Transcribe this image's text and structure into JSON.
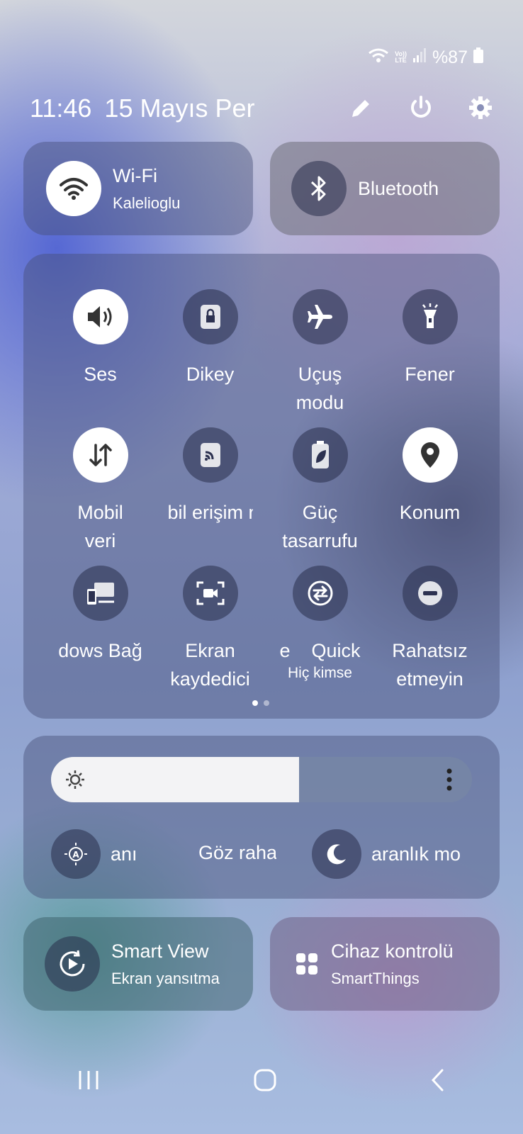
{
  "status_bar": {
    "volte_top": "Vo))",
    "volte_bottom": "LTE",
    "battery_text": "%87"
  },
  "header": {
    "time": "11:46",
    "date": "15 Mayıs Per"
  },
  "wifi": {
    "title": "Wi-Fi",
    "subtitle": "Kalelioglu",
    "state": "on"
  },
  "bluetooth": {
    "title": "Bluetooth",
    "state": "off"
  },
  "quick_settings": [
    {
      "label": "Ses",
      "icon": "speaker-icon",
      "state": "on"
    },
    {
      "label": "Dikey",
      "icon": "lock-rotation-icon",
      "state": "off"
    },
    {
      "label": "Uçuş\nmodu",
      "icon": "airplane-icon",
      "state": "off"
    },
    {
      "label": "Fener",
      "icon": "flashlight-icon",
      "state": "off"
    },
    {
      "label": "Mobil\nveri",
      "icon": "mobile-data-icon",
      "state": "on"
    },
    {
      "label": "bil erişim n",
      "icon": "hotspot-icon",
      "state": "off"
    },
    {
      "label": "Güç\ntasarrufu",
      "icon": "battery-saver-icon",
      "state": "off"
    },
    {
      "label": "Konum",
      "icon": "location-icon",
      "state": "on"
    },
    {
      "label": "dows Bağ",
      "icon": "link-to-windows-icon",
      "state": "off"
    },
    {
      "label": "Ekran\nkaydedici",
      "icon": "screen-recorder-icon",
      "state": "off"
    },
    {
      "label": "e    Quick",
      "sub": "Hiç kimse",
      "icon": "quick-share-icon",
      "state": "off"
    },
    {
      "label": "Rahatsız\netmeyin",
      "icon": "do-not-disturb-icon",
      "state": "off"
    }
  ],
  "page_indicator": {
    "pages": 2,
    "current": 1
  },
  "brightness": {
    "level": 0.59
  },
  "display_row": {
    "adaptive": "anı",
    "eye_comfort": "Göz raha",
    "dark_mode": "aranlık mo"
  },
  "smart_view": {
    "title": "Smart View",
    "subtitle": "Ekran yansıtma"
  },
  "device_control": {
    "title": "Cihaz kontrolü",
    "subtitle": "SmartThings"
  },
  "colors": {
    "accent_on": "#ffffff",
    "tile_off": "#2d3251"
  }
}
